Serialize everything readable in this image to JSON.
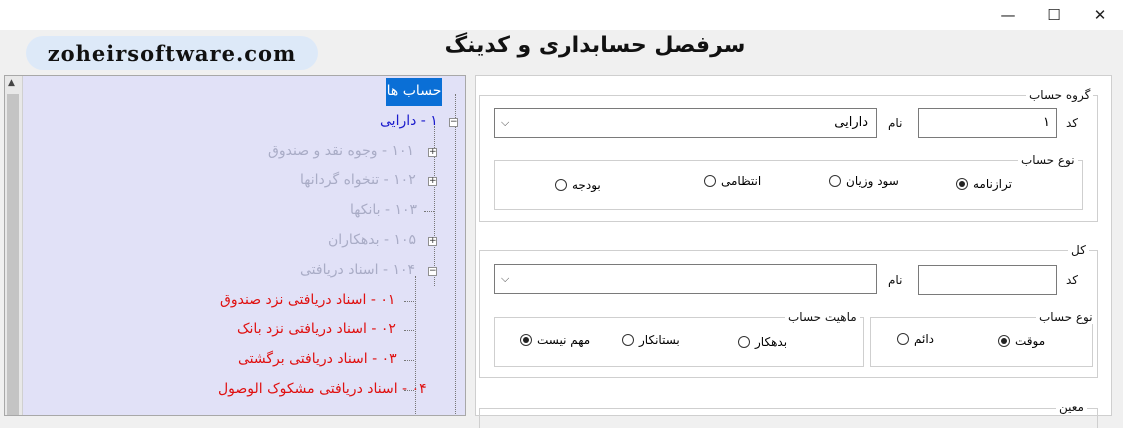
{
  "window": {
    "minimize_glyph": "—",
    "maximize_glyph": "☐",
    "close_glyph": "✕"
  },
  "brand": "zoheirsoftware.com",
  "app_title": "سرفصل حسابداری و کدینگ",
  "tree": {
    "root": "حساب ها",
    "nodes": [
      {
        "label": "۱ - دارایی",
        "color": "#1a1acc"
      },
      {
        "label": "۱۰۱ - وجوه نقد و صندوق",
        "color": "#a9acc6"
      },
      {
        "label": "۱۰۲ - تنخواه گردانها",
        "color": "#a9acc6"
      },
      {
        "label": "۱۰۳ - بانکها",
        "color": "#a9acc6"
      },
      {
        "label": "۱۰۵ - بدهکاران",
        "color": "#a9acc6"
      },
      {
        "label": "۱۰۴ - اسناد دریافتی",
        "color": "#a9acc6"
      },
      {
        "label": "۰۱ - اسناد دریافتی نزد صندوق",
        "color": "#e01010"
      },
      {
        "label": "۰۲ - اسناد دریافتی نزد بانک",
        "color": "#e01010"
      },
      {
        "label": "۰۳ - اسناد دریافتی برگشتی",
        "color": "#e01010"
      },
      {
        "label": "۰۴ - اسناد دریافتی مشکوک الوصول",
        "color": "#e01010"
      }
    ]
  },
  "group_section": {
    "legend": "گروه حساب",
    "code_label": "کد",
    "code_value": "۱",
    "name_label": "نام",
    "name_value": "دارایی",
    "type_legend": "نوع حساب",
    "type_options": [
      {
        "label": "ترازنامه",
        "checked": true
      },
      {
        "label": "سود وزیان",
        "checked": false
      },
      {
        "label": "انتظامی",
        "checked": false
      },
      {
        "label": "بودجه",
        "checked": false
      }
    ]
  },
  "kol_section": {
    "legend": "کل",
    "code_label": "کد",
    "code_value": "",
    "name_label": "نام",
    "name_value": "",
    "type_legend": "نوع حساب",
    "type_options": [
      {
        "label": "موقت",
        "checked": true
      },
      {
        "label": "دائم",
        "checked": false
      }
    ],
    "nature_legend": "ماهیت حساب",
    "nature_options": [
      {
        "label": "بدهکار",
        "checked": false
      },
      {
        "label": "بستانکار",
        "checked": false
      },
      {
        "label": "مهم نیست",
        "checked": true
      }
    ]
  },
  "moein_section": {
    "legend": "معین"
  }
}
